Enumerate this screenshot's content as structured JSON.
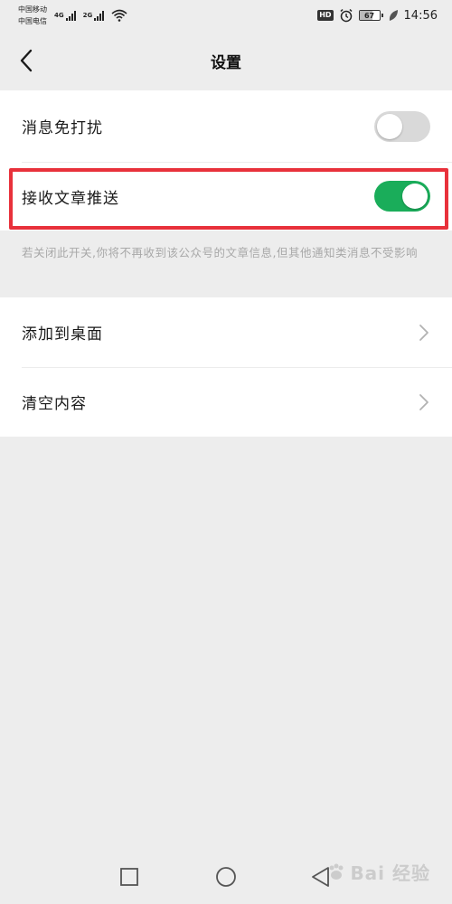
{
  "status_bar": {
    "carrier_1": "中国移动",
    "carrier_2": "中国电信",
    "network_1": "4G",
    "network_2": "2G",
    "hd": "HD",
    "battery": "67",
    "time": "14:56"
  },
  "nav": {
    "title": "设置"
  },
  "settings": {
    "dnd_label": "消息免打扰",
    "dnd_enabled": false,
    "push_label": "接收文章推送",
    "push_enabled": true,
    "hint": "若关闭此开关,你将不再收到该公众号的文章信息,但其他通知类消息不受影响",
    "add_desktop_label": "添加到桌面",
    "clear_content_label": "清空内容"
  },
  "colors": {
    "toggle_on": "#1aad5a",
    "toggle_off": "#d9d9d9",
    "highlight": "#e8313b",
    "background": "#ededed"
  },
  "watermark": {
    "text": "Bai 经验"
  }
}
